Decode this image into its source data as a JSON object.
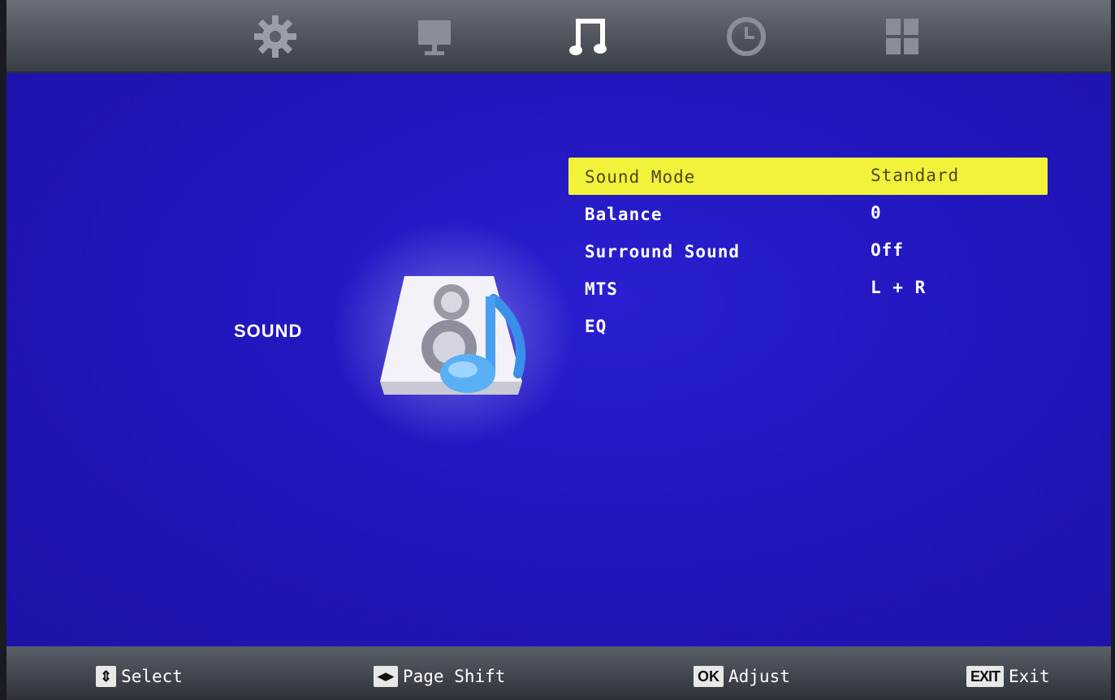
{
  "tabs": [
    {
      "name": "gear-icon"
    },
    {
      "name": "monitor-icon"
    },
    {
      "name": "music-note-icon",
      "active": true
    },
    {
      "name": "clock-icon"
    },
    {
      "name": "grid-icon"
    }
  ],
  "category": {
    "label": "SOUND",
    "icon": "speaker-music-icon"
  },
  "menu": {
    "items": [
      {
        "label": "Sound Mode",
        "value": "Standard",
        "selected": true
      },
      {
        "label": "Balance",
        "value": "0"
      },
      {
        "label": "Surround Sound",
        "value": "Off"
      },
      {
        "label": "MTS",
        "value": "L + R"
      },
      {
        "label": "EQ",
        "value": ""
      }
    ]
  },
  "footer": {
    "select": {
      "key": "⇕",
      "label": "Select"
    },
    "page_shift": {
      "key": "◀▶",
      "label": "Page Shift"
    },
    "adjust": {
      "key": "OK",
      "label": "Adjust"
    },
    "exit": {
      "key": "EXIT",
      "label": "Exit"
    }
  },
  "colors": {
    "background": "#2116bd",
    "highlight": "#f2f23a",
    "highlight_text": "#4a4a1c",
    "text": "#ffffff"
  }
}
